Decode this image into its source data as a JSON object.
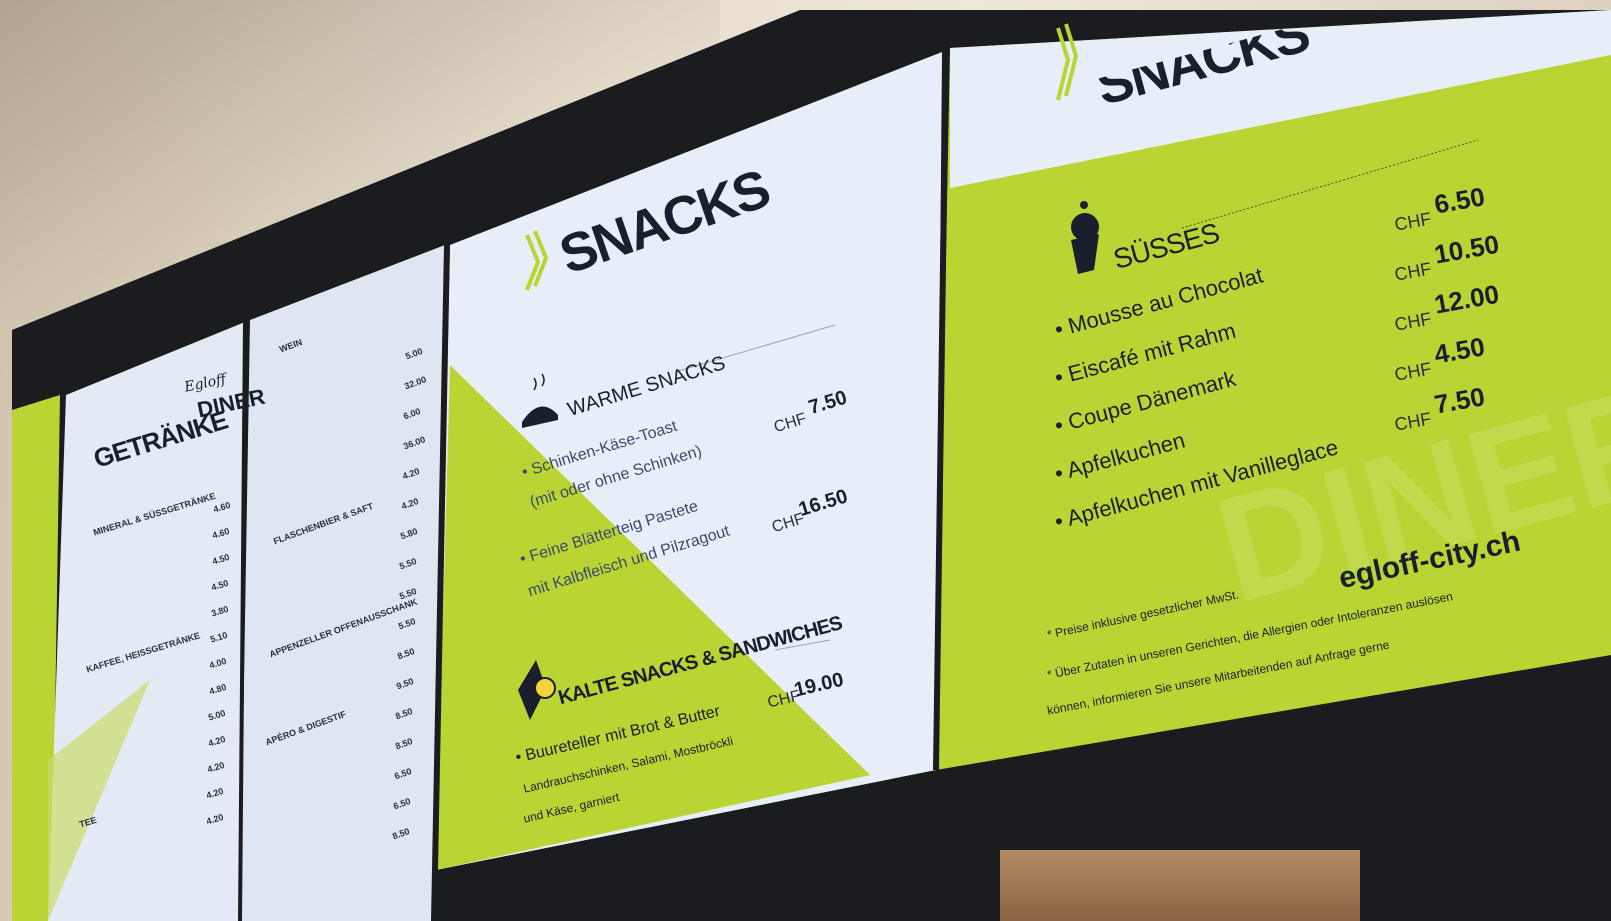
{
  "colors": {
    "lime": "#b9d433",
    "screen_light": "#e6ecf6",
    "bezel": "#1b1c1f",
    "text_dark": "#1a1f2e"
  },
  "board_left": {
    "logo_script": "Egloff",
    "logo": "DINER",
    "title": "GETRÄNKE",
    "sections": [
      "MINERAL & SÜSSGETRÄNKE",
      "KAFFEE, HEISSGETRÄNKE",
      "TEE"
    ],
    "prices": [
      "4.60",
      "4.60",
      "4.50",
      "4.50",
      "3.80",
      "5.10",
      "4.00",
      "4.80",
      "5.00",
      "4.20",
      "4.20",
      "4.20",
      "4.20"
    ]
  },
  "board_wine": {
    "sections": [
      "WEIN",
      "FLASCHENBIER & SAFT",
      "APPENZELLER OFFENAUSSCHANK",
      "APÉRO & DIGESTIF"
    ],
    "prices": [
      "5.00",
      "32.00",
      "6.00",
      "36.00",
      "4.20",
      "4.20",
      "5.80",
      "5.50",
      "5.50",
      "5.50",
      "8.50",
      "9.50",
      "8.50",
      "8.50",
      "6.50",
      "6.50",
      "8.50"
    ]
  },
  "board_center": {
    "title": "SNACKS",
    "warm": {
      "heading": "WARME SNACKS",
      "items": [
        {
          "line1": "• Schinken-Käse-Toast",
          "line2": "(mit oder ohne Schinken)",
          "currency": "CHF",
          "price": "7.50"
        },
        {
          "line1": "• Feine Blätterteig Pastete",
          "line2": "mit Kalbfleisch und Pilzragout",
          "currency": "CHF",
          "price": "16.50"
        }
      ]
    },
    "cold": {
      "heading": "KALTE SNACKS & SANDWICHES",
      "items": [
        {
          "line1": "• Buureteller mit Brot & Butter",
          "line2": "Landrauchschinken, Salami, Mostbröckli",
          "line3": "und Käse, garniert",
          "currency": "CHF",
          "price": "19.00"
        }
      ]
    }
  },
  "board_right": {
    "title": "SNACKS",
    "heading": "SÜSSES",
    "items": [
      {
        "name": "• Mousse au Chocolat",
        "currency": "CHF",
        "price": "6.50"
      },
      {
        "name": "• Eiscafé mit Rahm",
        "currency": "CHF",
        "price": "10.50"
      },
      {
        "name": "• Coupe Dänemark",
        "currency": "CHF",
        "price": "12.00"
      },
      {
        "name": "• Apfelkuchen",
        "currency": "CHF",
        "price": "4.50"
      },
      {
        "name": "• Apfelkuchen mit Vanilleglace",
        "currency": "CHF",
        "price": "7.50"
      }
    ],
    "website": "egloff-city.ch",
    "note1": "* Preise inklusive gesetzlicher MwSt.",
    "note2": "* Über Zutaten in unseren Gerichten, die Allergien oder Intoleranzen auslösen",
    "note3": "können, informieren Sie unsere Mitarbeitenden auf Anfrage gerne",
    "watermark": "DINER"
  }
}
